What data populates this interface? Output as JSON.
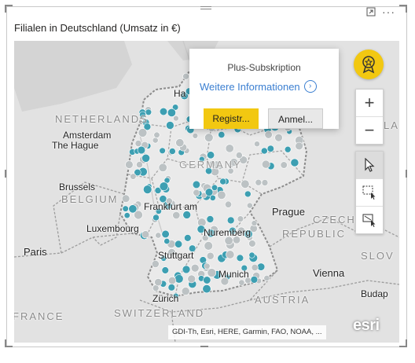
{
  "visual": {
    "title": "Filialen in Deutschland (Umsatz in €)",
    "focus_icon": "focus-mode-icon",
    "more_icon": "more-options-icon",
    "more_glyph": "···"
  },
  "map": {
    "labels": {
      "netherlands": "NETHERLANDS",
      "amsterdam": "Amsterdam",
      "the_hague": "The Hague",
      "brussels": "Brussels",
      "belgium": "BELGIUM",
      "luxembourg": "Luxembourg",
      "paris": "Paris",
      "france": "FRANCE",
      "switzerland": "SWITZERLAND",
      "zurich": "Zürich",
      "austria": "AUSTRIA",
      "vienna": "Vienna",
      "budapest": "Budap",
      "slovakia": "SLOV",
      "prague": "Prague",
      "czech": "CZECH",
      "republic": "REPUBLIC",
      "germany": "GERMANY",
      "la": "LA",
      "hamburg": "Ha",
      "frankfurt": "Frankfurt am",
      "nuremberg": "Nuremberg",
      "stuttgart": "Stuttgart",
      "munich": "Munich"
    },
    "attribution": "GDI-Th, Esri, HERE, Garmin, FAO, NOAA, ...",
    "esri": "esri",
    "colors": {
      "teal": "#3d9fb2",
      "grey": "#bcc2c4",
      "land": "#e2e2e2",
      "border": "#8c8c8c"
    }
  },
  "popup": {
    "title": "Plus-Subskription",
    "link": "Weitere Informationen",
    "register": "Registr...",
    "signin": "Anmel..."
  },
  "toolbar": {
    "zoom_in": "+",
    "zoom_out": "−",
    "select_icon": "pointer-icon",
    "rect_select_icon": "rectangle-select-icon",
    "lasso_select_icon": "lasso-select-icon"
  }
}
